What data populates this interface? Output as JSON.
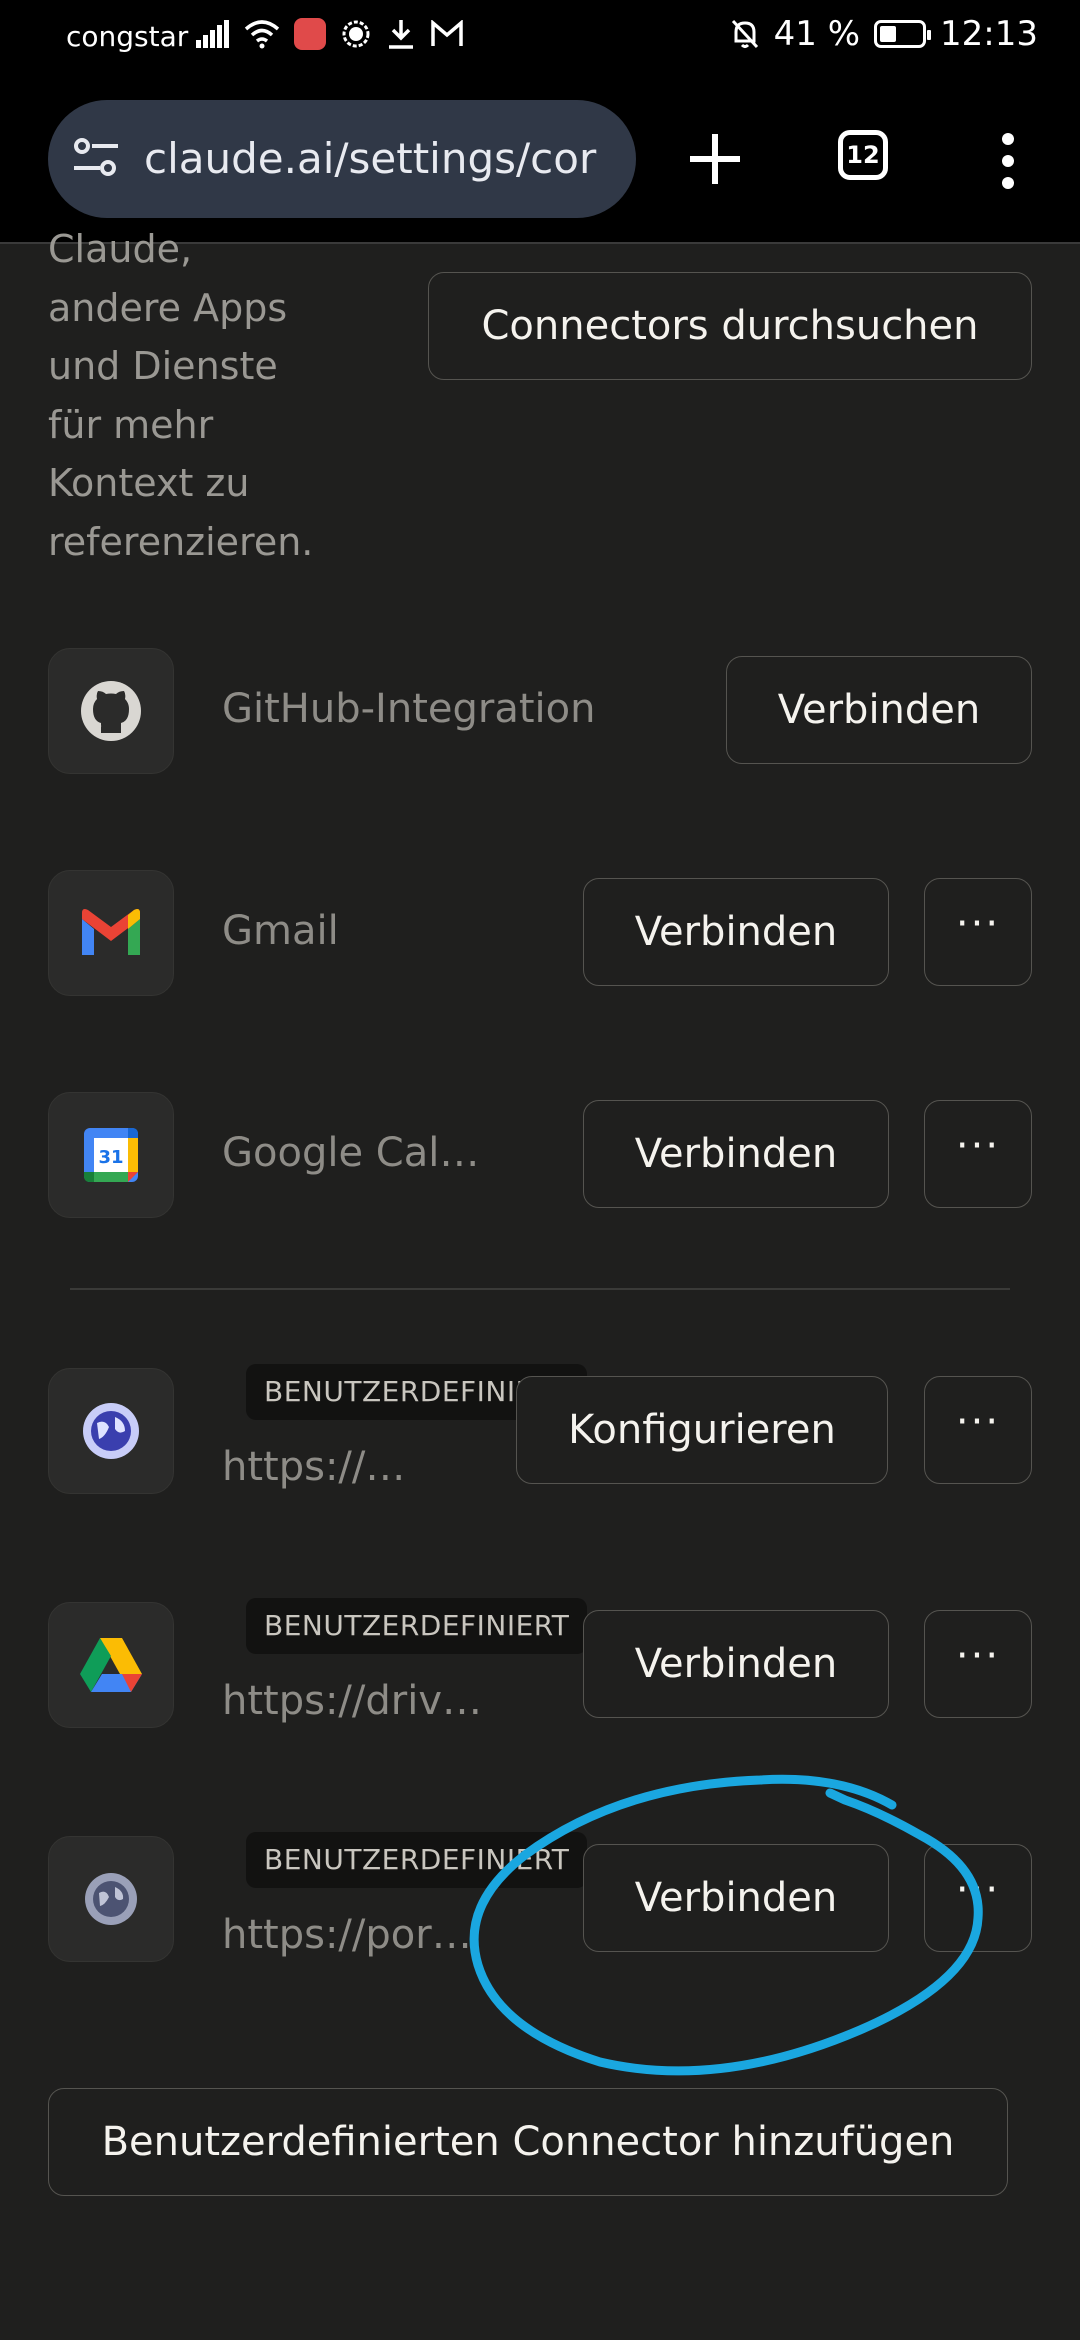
{
  "status_bar": {
    "carrier": "congstar",
    "battery_percent": "41 %",
    "battery_level": 0.41,
    "time": "12:13"
  },
  "browser": {
    "url": "claude.ai/settings/cor",
    "tab_count": "12"
  },
  "intro": {
    "lines": [
      "Claude,",
      "andere Apps",
      "und Dienste",
      "für mehr",
      "Kontext zu",
      "referenzieren."
    ]
  },
  "search_button_label": "Connectors durchsuchen",
  "connectors": [
    {
      "name": "GitHub-Integration",
      "icon": "github-icon",
      "action": "Verbinden"
    },
    {
      "name": "Gmail",
      "icon": "gmail-icon",
      "action": "Verbinden",
      "more": "···"
    },
    {
      "name": "Google Cal…",
      "icon": "google-calendar-icon",
      "calendar_day": "31",
      "action": "Verbinden",
      "more": "···"
    }
  ],
  "custom_connectors": [
    {
      "badge": "BENUTZERDEFINIERT",
      "url": "https://…",
      "icon": "globe-icon",
      "action": "Konfigurieren",
      "more": "···"
    },
    {
      "badge": "BENUTZERDEFINIERT",
      "url": "https://driv…",
      "icon": "google-drive-icon",
      "action": "Verbinden",
      "more": "···"
    },
    {
      "badge": "BENUTZERDEFINIERT",
      "url": "https://por…",
      "icon": "globe-icon",
      "action": "Verbinden",
      "more": "···"
    }
  ],
  "add_custom_button_label": "Benutzerdefinierten Connector hinzufügen",
  "colors": {
    "background": "#1f1f1e",
    "annotation": "#1aa7e0",
    "url_bar": "#303847"
  }
}
